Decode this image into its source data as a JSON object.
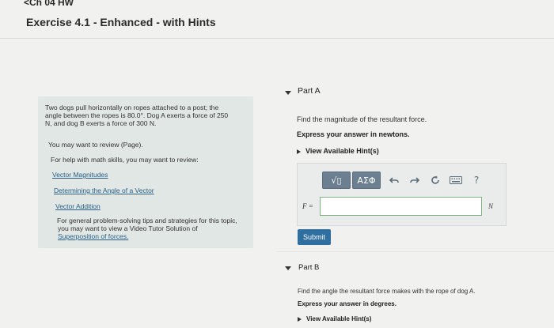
{
  "nav": {
    "back": "<Ch 04 HW"
  },
  "page_title": "Exercise 4.1 - Enhanced - with Hints",
  "side": {
    "problem_line1": "Two dogs pull horizontally on ropes attached to a post; the",
    "problem_line2": "angle between the ropes is 80.0°. Dog A exerts a force of 250",
    "problem_line3": "N, and dog B exerts a force of 300 N.",
    "review_line": "You may want to review (Page).",
    "math_help": "For help with math skills, you may want to review:",
    "links": [
      "Vector Magnitudes",
      "Determining the Angle of a Vector",
      "Vector Addition"
    ],
    "tips_line1": "For general problem-solving tips and strategies for this topic,",
    "tips_line2": "you may want to view a Video Tutor Solution of",
    "tips_link": "Superposition of forces."
  },
  "part_a": {
    "label": "Part A",
    "question": "Find the magnitude of the resultant force.",
    "instruction": "Express your answer in newtons.",
    "hints": "View Available Hint(s)",
    "toolbar": {
      "templates_label": "√▯",
      "greek_label": "ΑΣΦ",
      "icons": [
        "undo-icon",
        "redo-icon",
        "reset-icon",
        "keyboard-icon",
        "help-icon"
      ],
      "help_glyph": "?"
    },
    "variable_label": "F =",
    "input_value": "",
    "unit": "N",
    "submit_label": "Submit"
  },
  "part_b": {
    "label": "Part B",
    "question": "Find the angle the resultant force makes with the rope of dog A.",
    "instruction": "Express your answer in degrees.",
    "hints": "View Available Hint(s)"
  },
  "colors": {
    "side_panel": "#e0e7e4",
    "link": "#2b5f86",
    "submit": "#2f6f9f",
    "toolbar_button": "#6c7f91",
    "input_border": "#7fb27f"
  }
}
